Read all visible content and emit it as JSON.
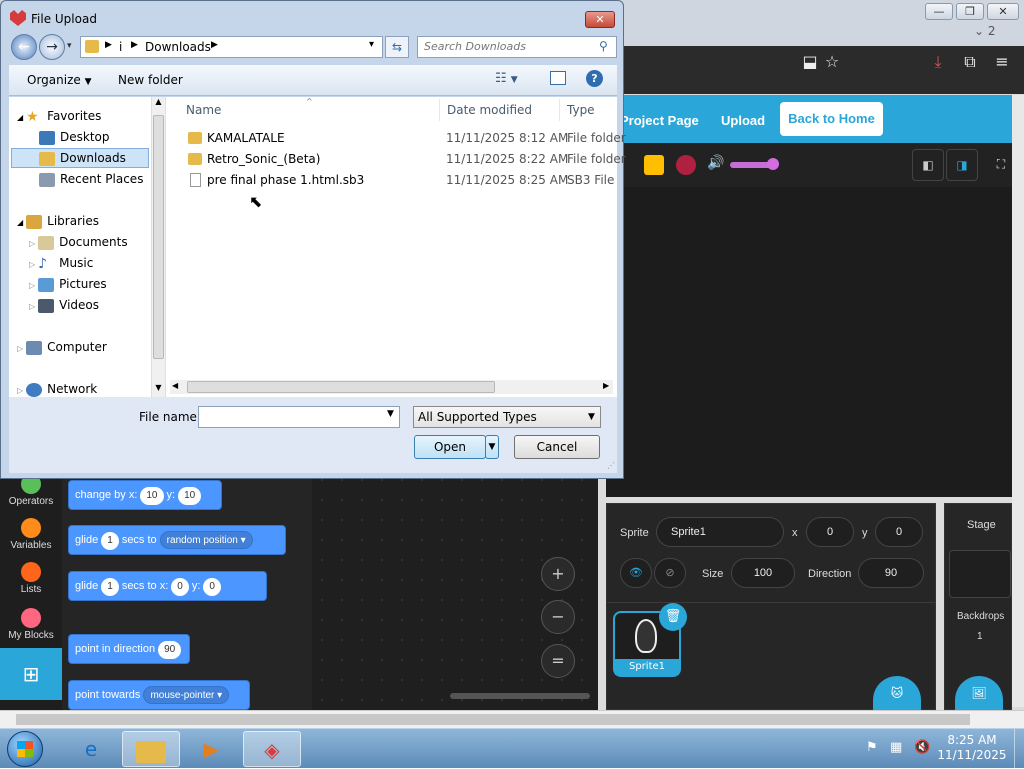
{
  "browser": {
    "tab_count": "2",
    "minimize": "—",
    "restore": "❐",
    "close": "✕"
  },
  "scratch": {
    "header": {
      "project_page": "Project Page",
      "upload": "Upload",
      "back_to_home": "Back to Home"
    },
    "categories": [
      {
        "label": "Operators",
        "color": "#59c059"
      },
      {
        "label": "Variables",
        "color": "#ff8c1a"
      },
      {
        "label": "Lists",
        "color": "#ff661a"
      },
      {
        "label": "My Blocks",
        "color": "#ff6680"
      }
    ],
    "blocks": {
      "change_by": {
        "text1": "change by x:",
        "x": "10",
        "text2": "y:",
        "y": "10"
      },
      "glide_random": {
        "text1": "glide",
        "secs": "1",
        "text2": "secs to",
        "target": "random position"
      },
      "glide_xy": {
        "text1": "glide",
        "secs": "1",
        "text2": "secs to x:",
        "x": "0",
        "text3": "y:",
        "y": "0"
      },
      "point_direction": {
        "text1": "point in direction",
        "value": "90"
      },
      "point_towards": {
        "text1": "point towards",
        "target": "mouse-pointer"
      }
    },
    "zoom": {
      "in": "+",
      "out": "−",
      "reset": "="
    },
    "sprite": {
      "label": "Sprite",
      "name": "Sprite1",
      "x_label": "x",
      "x": "0",
      "y_label": "y",
      "y": "0",
      "size_label": "Size",
      "size": "100",
      "direction_label": "Direction",
      "direction": "90",
      "thumb_name": "Sprite1"
    },
    "stage": {
      "label": "Stage",
      "backdrops_label": "Backdrops",
      "backdrops_count": "1"
    }
  },
  "dialog": {
    "title": "File Upload",
    "address": {
      "root": "i",
      "current": "Downloads"
    },
    "search_placeholder": "Search Downloads",
    "organize": "Organize",
    "new_folder": "New folder",
    "nav": {
      "favorites": "Favorites",
      "desktop": "Desktop",
      "downloads": "Downloads",
      "recent_places": "Recent Places",
      "libraries": "Libraries",
      "documents": "Documents",
      "music": "Music",
      "pictures": "Pictures",
      "videos": "Videos",
      "computer": "Computer",
      "network": "Network"
    },
    "columns": {
      "name": "Name",
      "date": "Date modified",
      "type": "Type"
    },
    "files": [
      {
        "name": "KAMALATALE",
        "date": "11/11/2025 8:12 AM",
        "type": "File folder",
        "icon": "folder-icon"
      },
      {
        "name": "Retro_Sonic_(Beta)",
        "date": "11/11/2025 8:22 AM",
        "type": "File folder",
        "icon": "folder-icon"
      },
      {
        "name": "pre final phase 1.html.sb3",
        "date": "11/11/2025 8:25 AM",
        "type": "SB3 File",
        "icon": "file-icon"
      }
    ],
    "file_name_label": "File name:",
    "file_name_value": "",
    "file_type": "All Supported Types",
    "open": "Open",
    "cancel": "Cancel"
  },
  "taskbar": {
    "time": "8:25 AM",
    "date": "11/11/2025"
  }
}
